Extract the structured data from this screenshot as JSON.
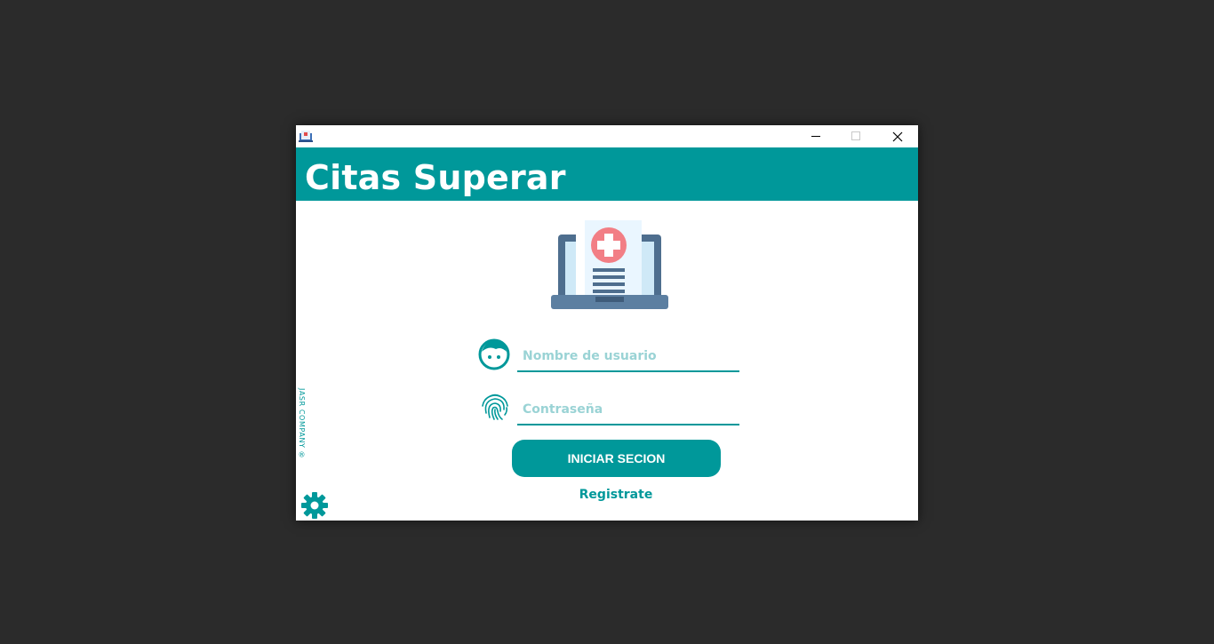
{
  "window": {
    "controls": {
      "minimize_icon": "minimize-icon",
      "maximize_icon": "maximize-icon",
      "close_icon": "close-icon"
    }
  },
  "header": {
    "title": "Citas Superar",
    "color": "#00989a"
  },
  "login": {
    "username_placeholder": "Nombre de usuario",
    "password_placeholder": "Contraseña",
    "submit_label": "INICIAR SECION",
    "register_label": "Registrate"
  },
  "footer": {
    "company": "JASR COMPANY ®"
  },
  "icons": {
    "user": "user-face-icon",
    "password": "fingerprint-icon",
    "settings": "gear-icon",
    "illustration": "medical-laptop-illustration"
  }
}
